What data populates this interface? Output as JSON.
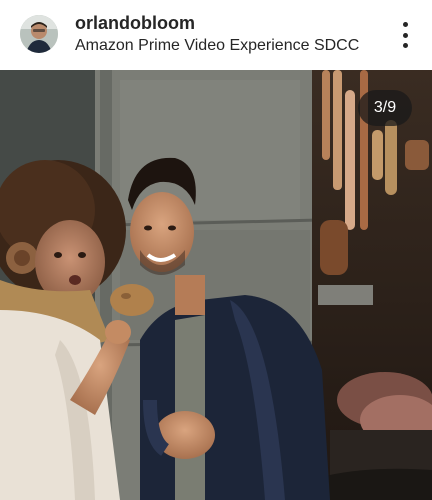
{
  "header": {
    "username": "orlandobloom",
    "location": "Amazon Prime Video Experience SDCC",
    "avatar_icon": "profile-avatar",
    "more_icon": "more-vertical-icon"
  },
  "post": {
    "counter": "3/9",
    "image_description_icon": "photo"
  }
}
